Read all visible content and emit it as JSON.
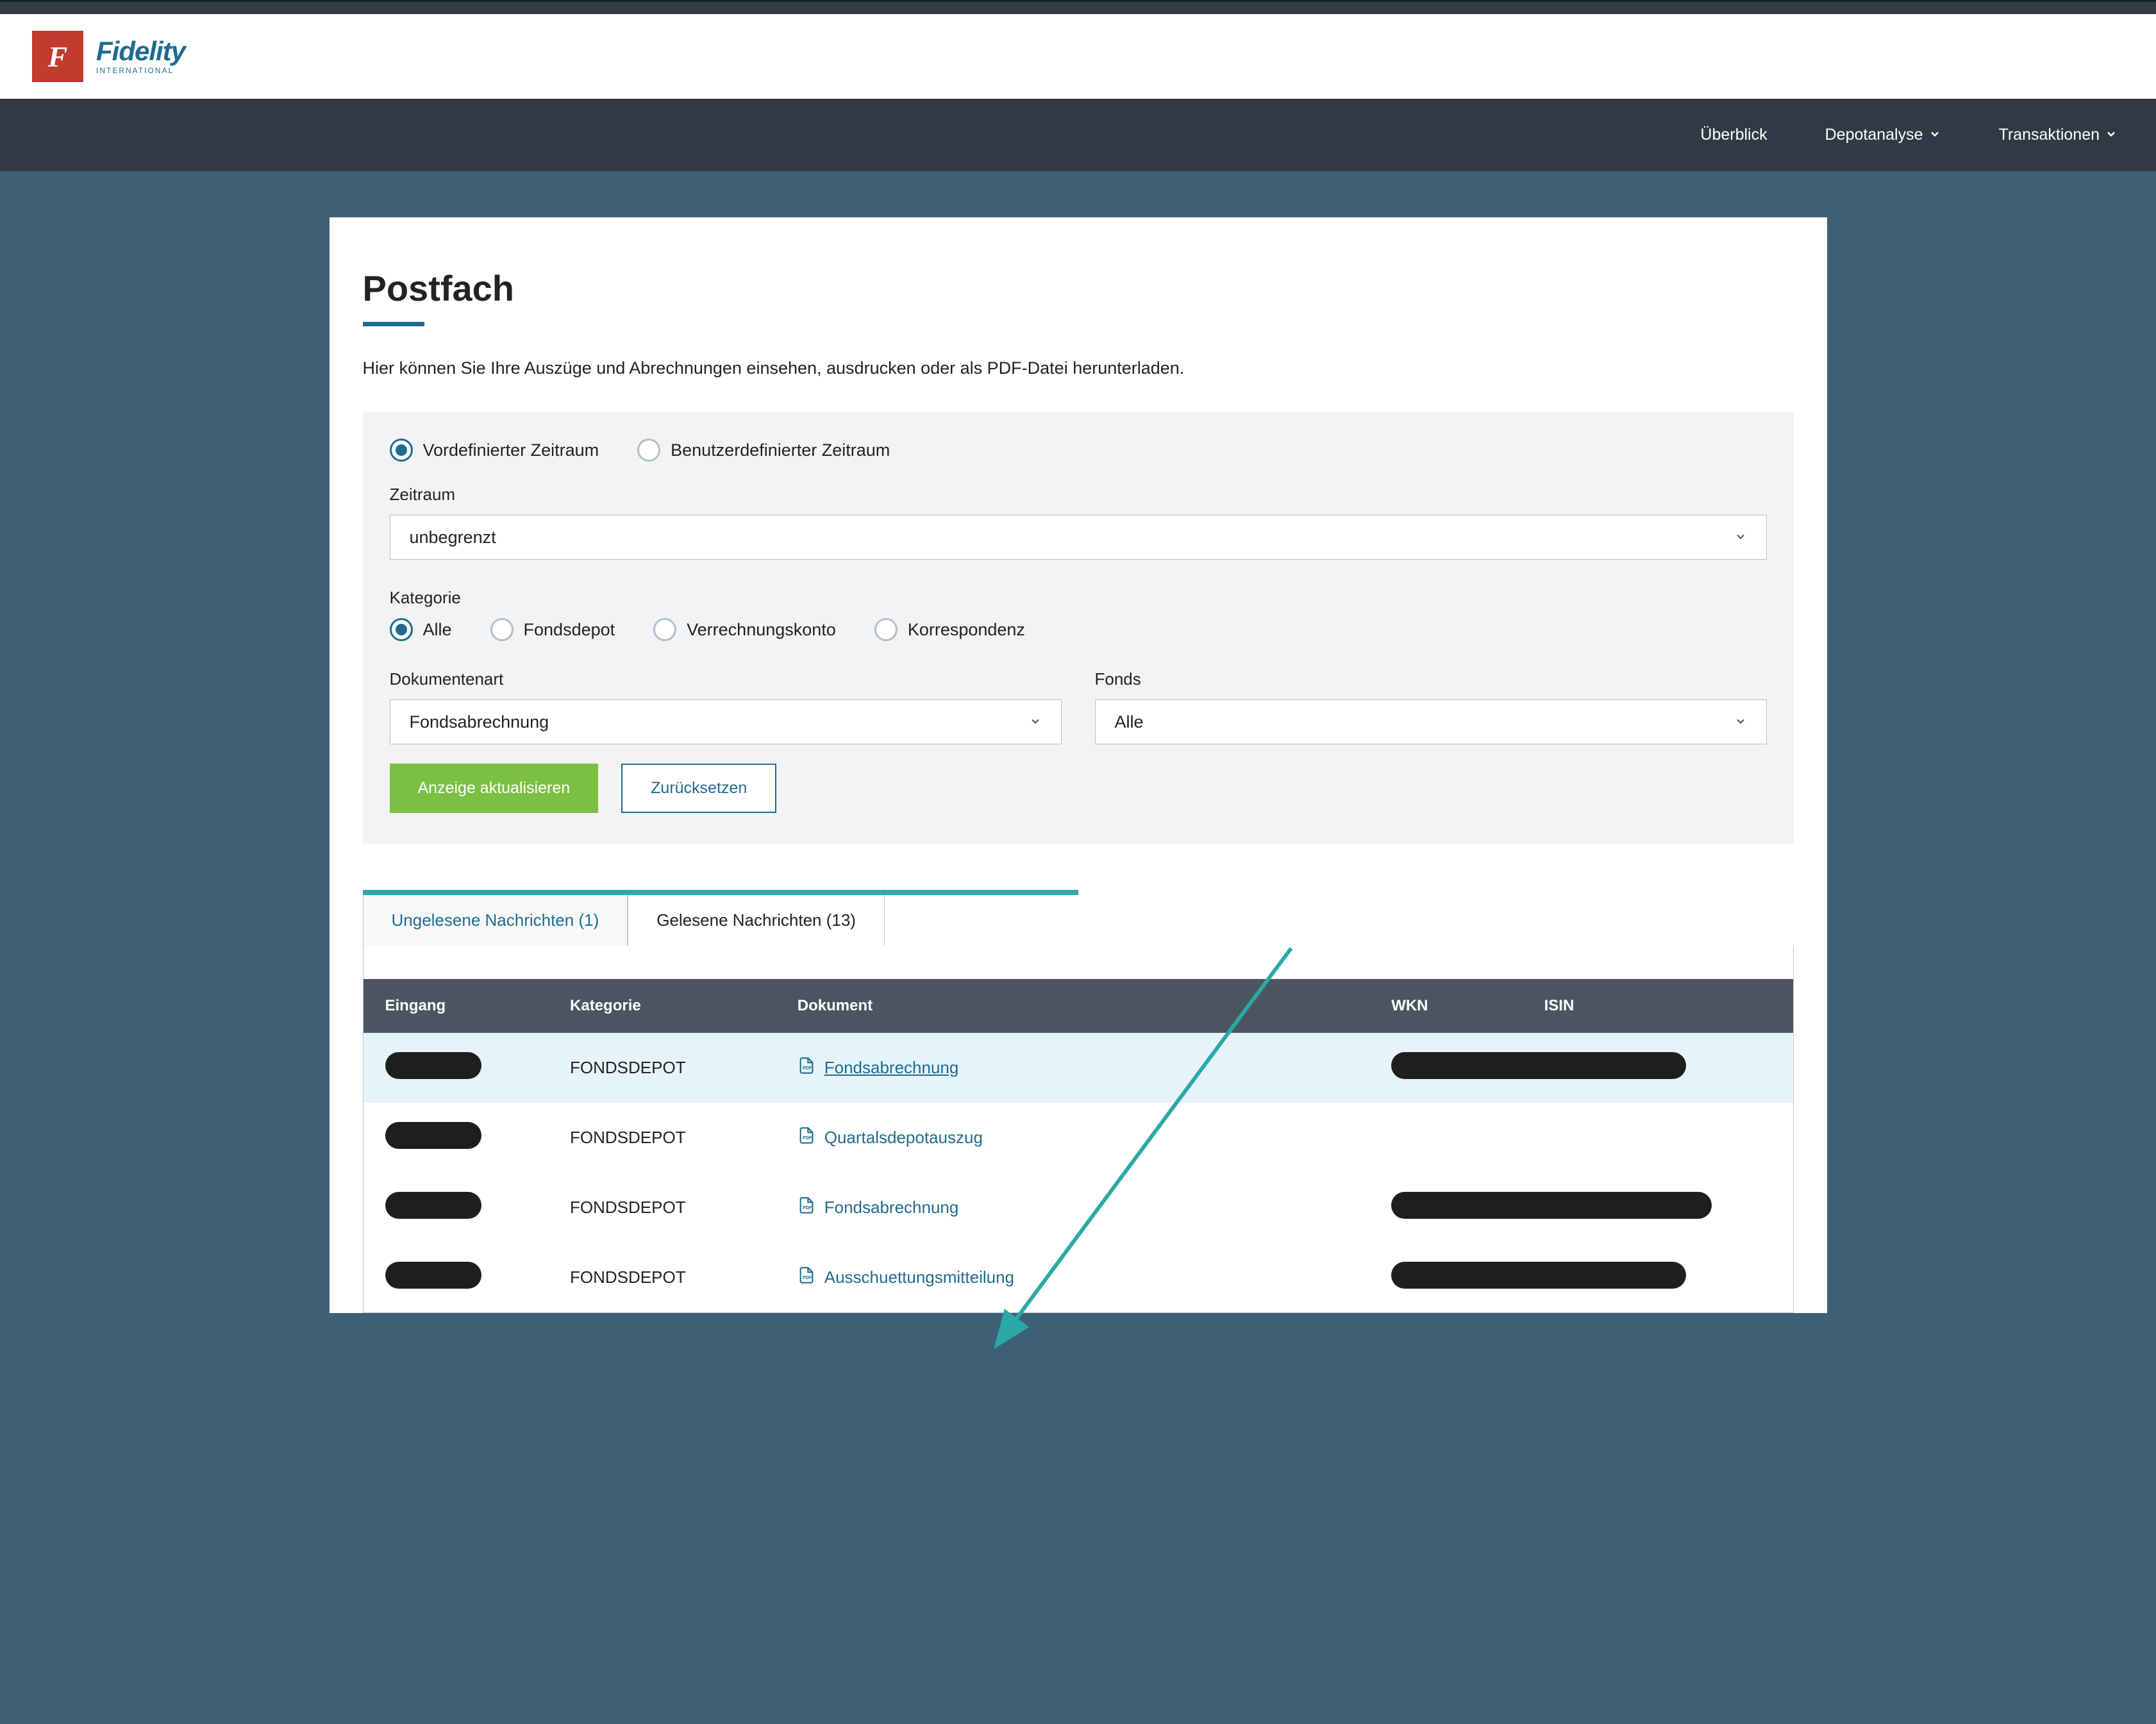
{
  "brand": {
    "logo_letter": "F",
    "name": "Fidelity",
    "sub": "INTERNATIONAL"
  },
  "nav": {
    "overview": "Überblick",
    "depot_analysis": "Depotanalyse",
    "transactions": "Transaktionen"
  },
  "page": {
    "title": "Postfach",
    "description": "Hier können Sie Ihre Auszüge und Abrechnungen einsehen, ausdrucken oder als PDF-Datei herunterladen."
  },
  "filters": {
    "period_mode": {
      "predefined": "Vordefinierter Zeitraum",
      "custom": "Benutzerdefinierter Zeitraum"
    },
    "period_label": "Zeitraum",
    "period_value": "unbegrenzt",
    "category_label": "Kategorie",
    "categories": {
      "all": "Alle",
      "fondsdepot": "Fondsdepot",
      "verrechnungskonto": "Verrechnungskonto",
      "korrespondenz": "Korrespondenz"
    },
    "doc_type_label": "Dokumentenart",
    "doc_type_value": "Fondsabrechnung",
    "fonds_label": "Fonds",
    "fonds_value": "Alle",
    "update_btn": "Anzeige aktualisieren",
    "reset_btn": "Zurücksetzen"
  },
  "tabs": {
    "unread": "Ungelesene Nachrichten (1)",
    "read": "Gelesene Nachrichten (13)"
  },
  "table": {
    "headers": {
      "eingang": "Eingang",
      "kategorie": "Kategorie",
      "dokument": "Dokument",
      "wkn": "WKN",
      "isin": "ISIN"
    },
    "rows": [
      {
        "kategorie": "FONDSDEPOT",
        "dokument": "Fondsabrechnung",
        "highlight": true,
        "underline": true,
        "wkn_isin_redacted": true
      },
      {
        "kategorie": "FONDSDEPOT",
        "dokument": "Quartalsdepotauszug",
        "highlight": false,
        "underline": false,
        "wkn_isin_redacted": false
      },
      {
        "kategorie": "FONDSDEPOT",
        "dokument": "Fondsabrechnung",
        "highlight": false,
        "underline": false,
        "wkn_isin_redacted": true
      },
      {
        "kategorie": "FONDSDEPOT",
        "dokument": "Ausschuettungsmitteilung",
        "highlight": false,
        "underline": false,
        "wkn_isin_redacted": true
      }
    ]
  }
}
